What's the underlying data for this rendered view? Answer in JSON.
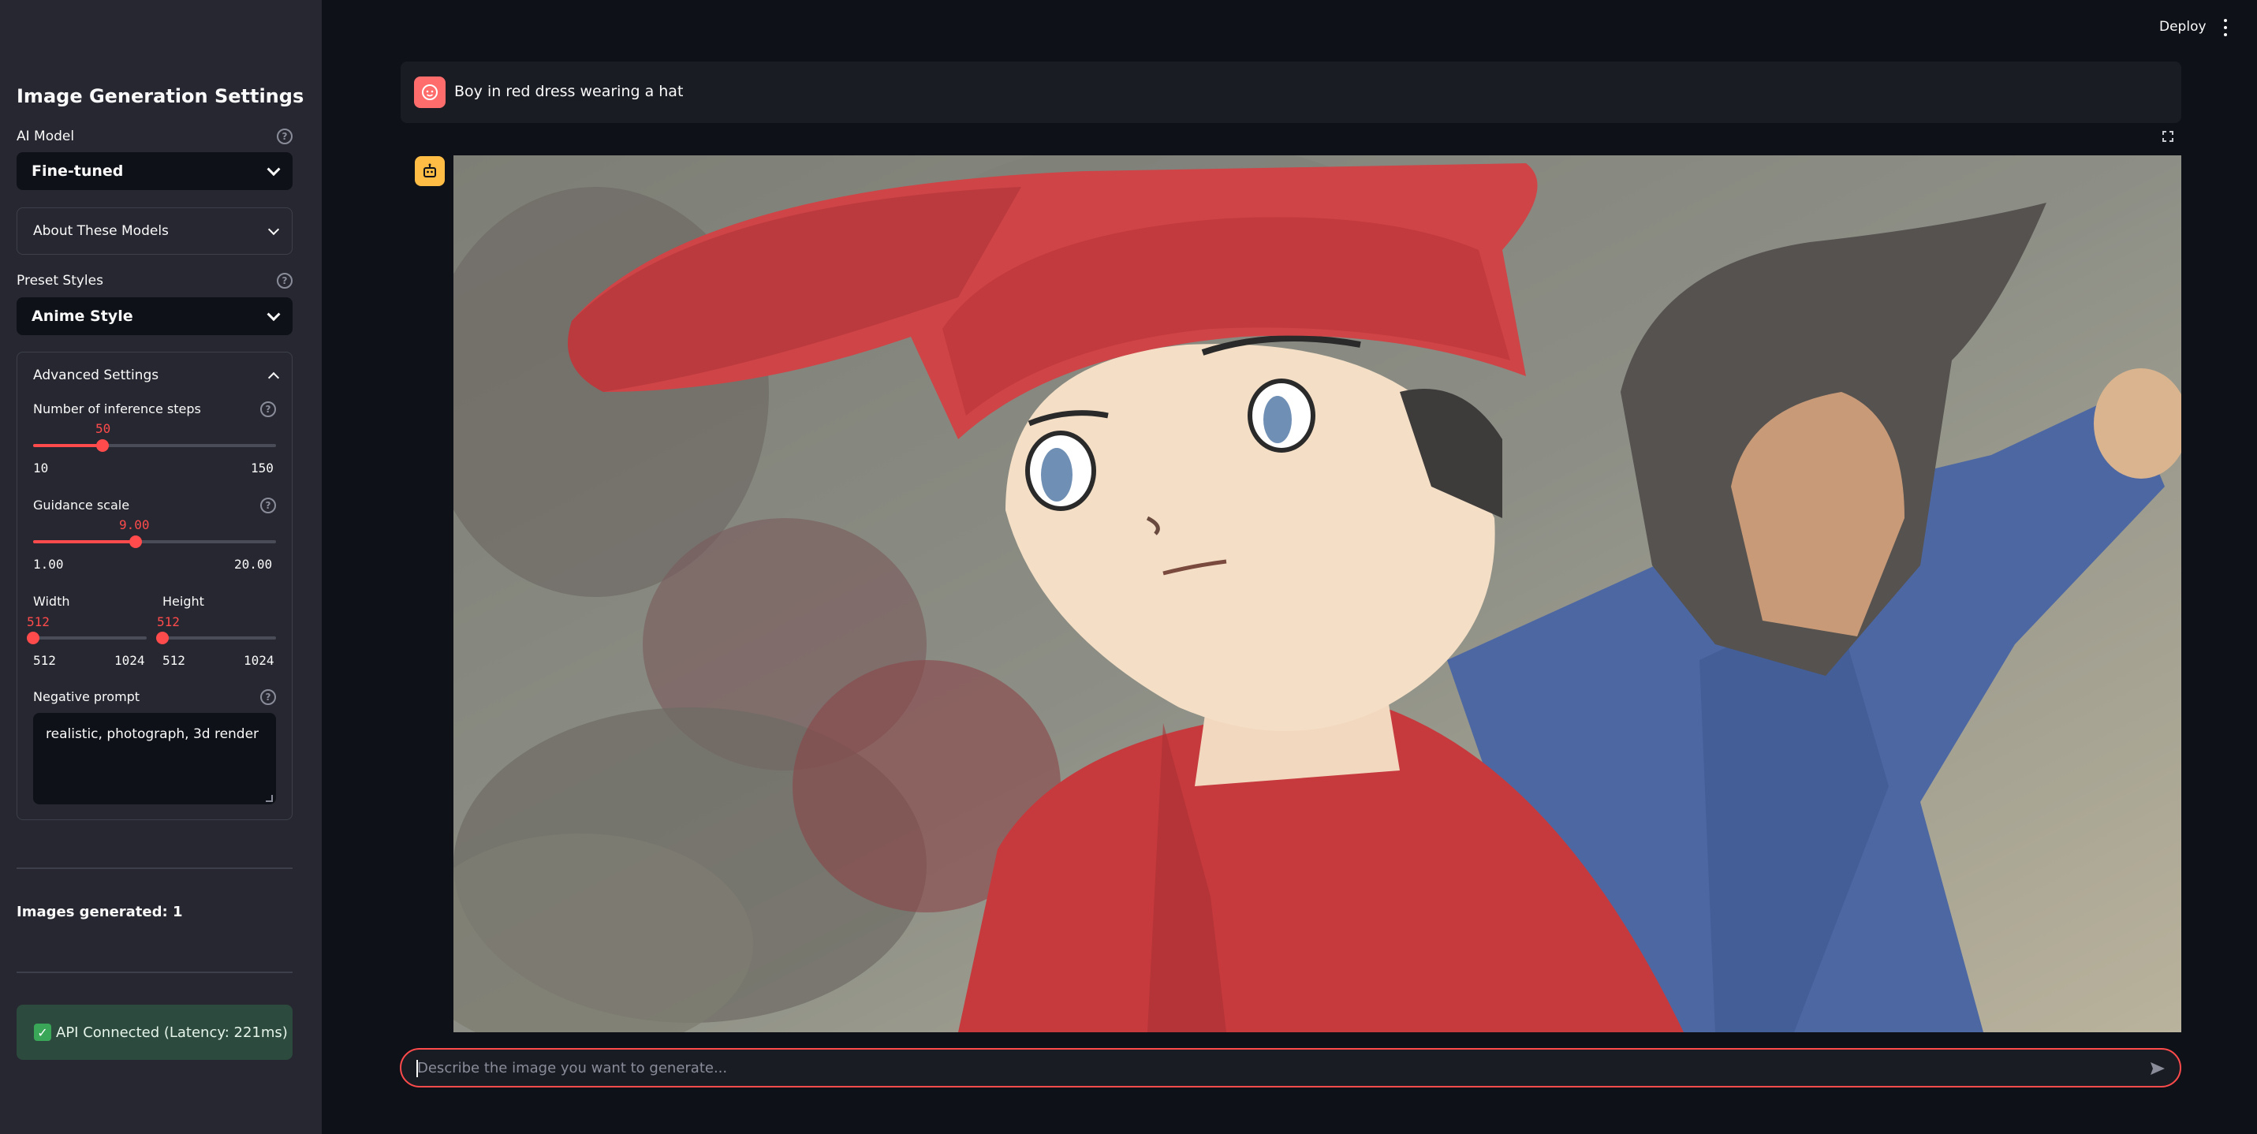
{
  "sidebar": {
    "title": "Image Generation Settings",
    "model": {
      "label": "AI Model",
      "value": "Fine-tuned"
    },
    "about": {
      "label": "About These Models"
    },
    "preset": {
      "label": "Preset Styles",
      "value": "Anime Style"
    },
    "advanced": {
      "label": "Advanced Settings",
      "steps": {
        "label": "Number of inference steps",
        "value": "50",
        "min": "10",
        "max": "150",
        "fraction": 0.286
      },
      "guidance": {
        "label": "Guidance scale",
        "value": "9.00",
        "min": "1.00",
        "max": "20.00",
        "fraction": 0.421
      },
      "width": {
        "label": "Width",
        "value": "512",
        "min": "512",
        "max": "1024",
        "fraction": 0
      },
      "height": {
        "label": "Height",
        "value": "512",
        "min": "512",
        "max": "1024",
        "fraction": 0
      },
      "negative": {
        "label": "Negative prompt",
        "value": "realistic, photograph, 3d render"
      }
    },
    "images_generated": "Images generated: 1",
    "api_status": "API Connected (Latency: 221ms)"
  },
  "header": {
    "deploy": "Deploy"
  },
  "chat": {
    "user_message": "Boy in red dress wearing a hat",
    "input_placeholder": "Describe the image you want to generate..."
  },
  "colors": {
    "accent": "#ff4b4b",
    "user_avatar": "#ff6c6c",
    "bot_avatar": "#ffbd45",
    "api_ok": "#2c4a3e"
  }
}
